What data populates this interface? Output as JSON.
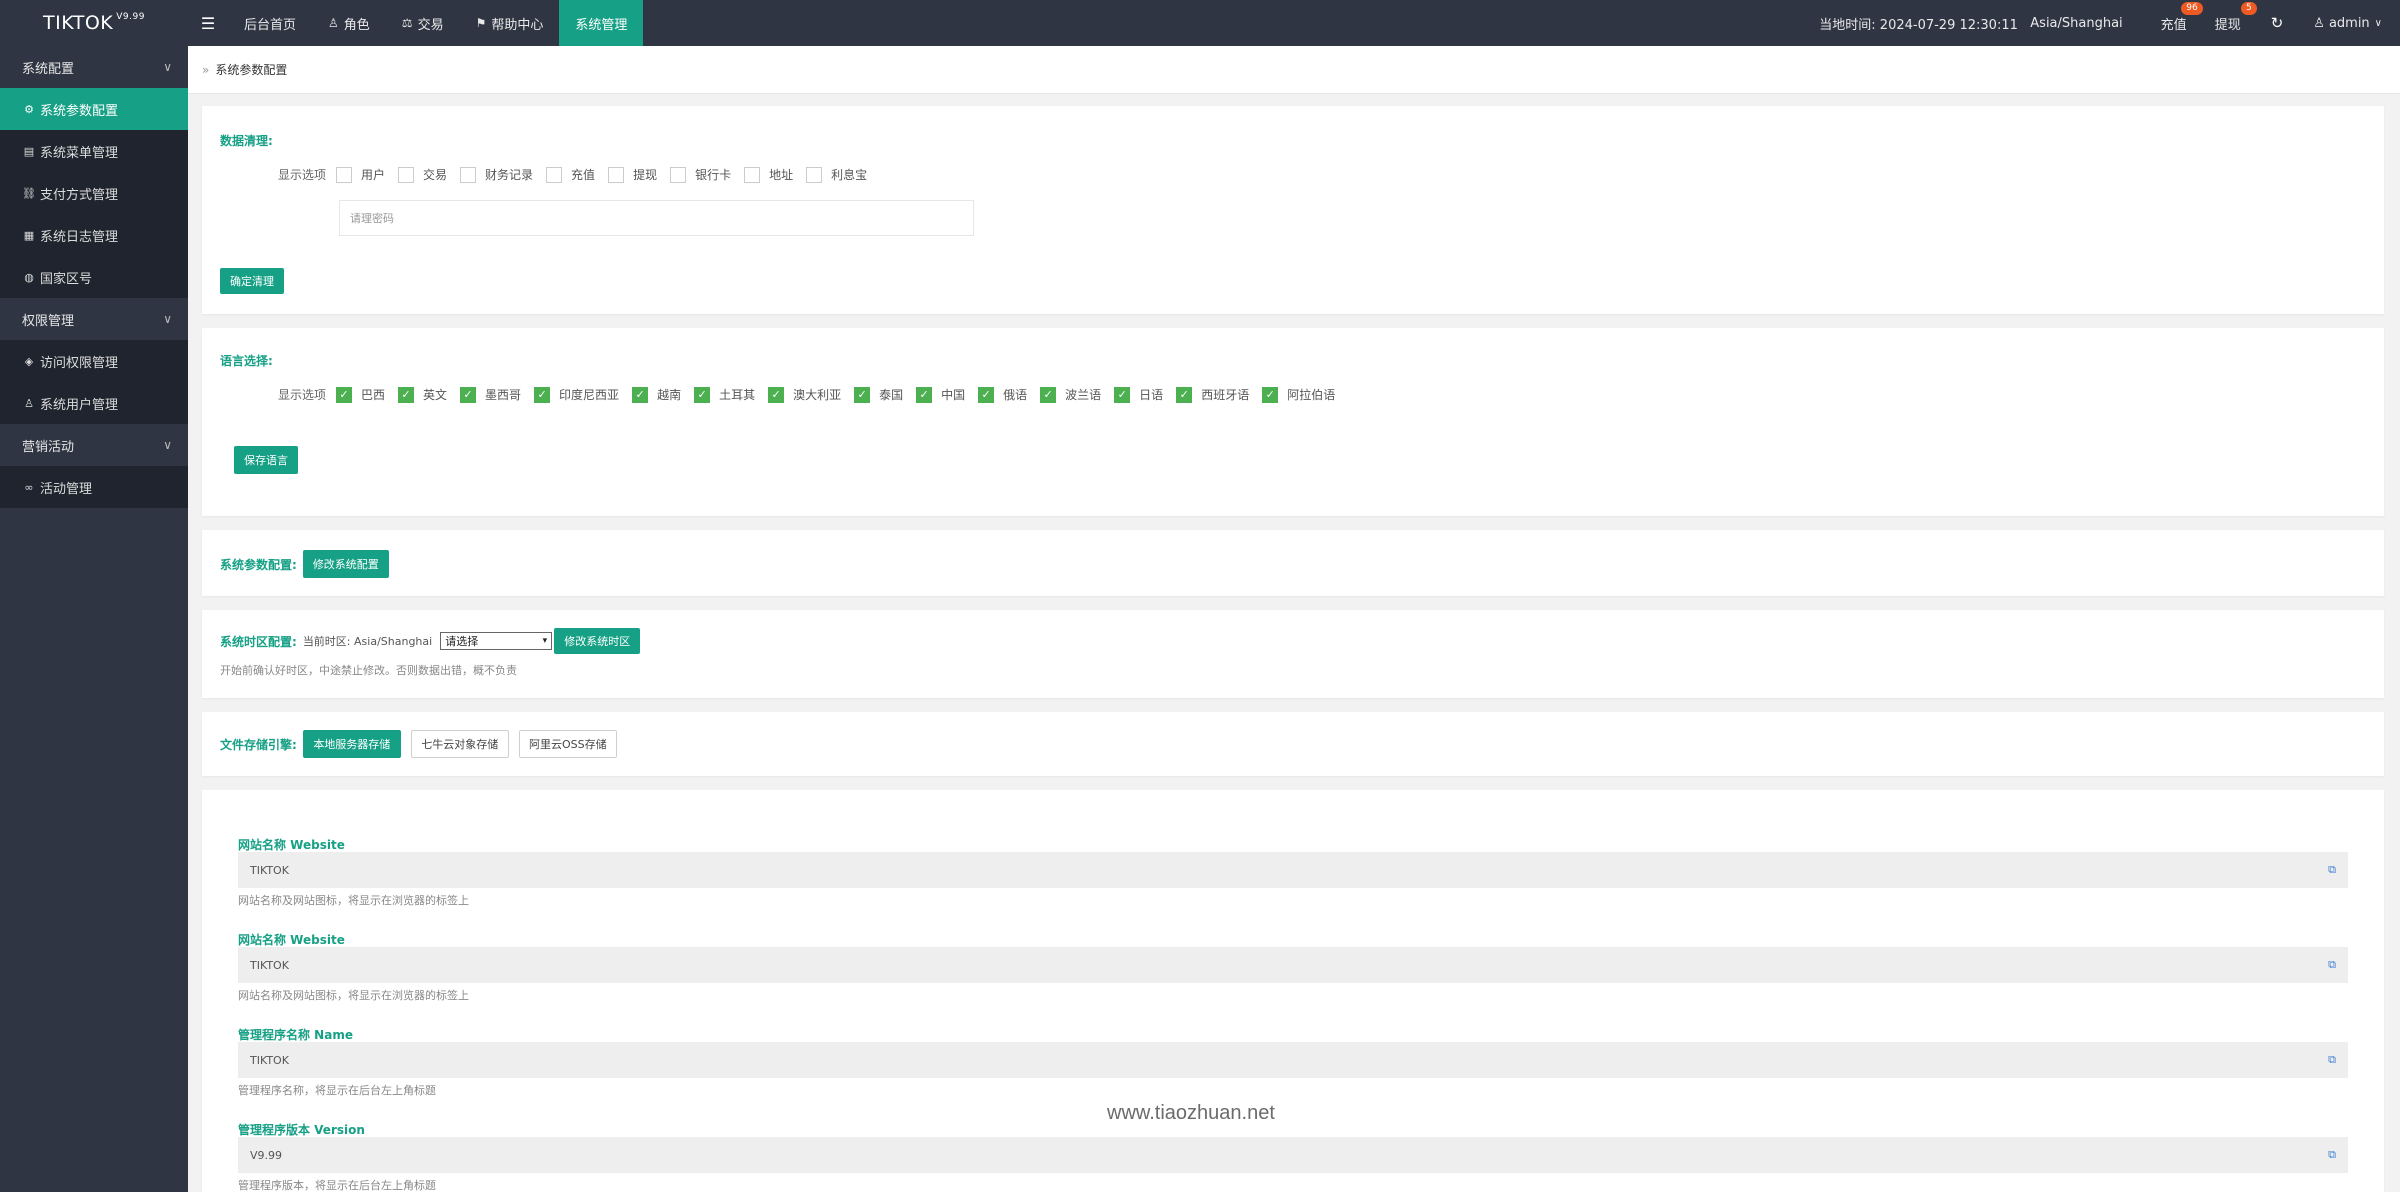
{
  "app": {
    "logo": "TIKTOK",
    "version": "V9.99"
  },
  "topnav": {
    "items": [
      {
        "label": "后台首页",
        "icon": ""
      },
      {
        "label": "角色",
        "icon": "user-icon"
      },
      {
        "label": "交易",
        "icon": "scale-icon"
      },
      {
        "label": "帮助中心",
        "icon": "flag-icon"
      },
      {
        "label": "系统管理",
        "icon": ""
      }
    ],
    "time_label": "当地时间: 2024-07-29 12:30:11",
    "timezone": "Asia/Shanghai",
    "recharge": {
      "label": "充值",
      "badge": "96"
    },
    "withdraw": {
      "label": "提现",
      "badge": "5"
    },
    "user": "admin"
  },
  "sidebar": {
    "groups": [
      {
        "label": "系统配置"
      },
      {
        "label": "权限管理"
      },
      {
        "label": "营销活动"
      }
    ],
    "items": [
      {
        "label": "系统参数配置",
        "icon": "gear-icon"
      },
      {
        "label": "系统菜单管理",
        "icon": "calendar-icon"
      },
      {
        "label": "支付方式管理",
        "icon": "link-icon"
      },
      {
        "label": "系统日志管理",
        "icon": "document-icon"
      },
      {
        "label": "国家区号",
        "icon": "globe-icon"
      },
      {
        "label": "访问权限管理",
        "icon": "shield-check-icon"
      },
      {
        "label": "系统用户管理",
        "icon": "user-icon"
      },
      {
        "label": "活动管理",
        "icon": "infinity-icon"
      }
    ]
  },
  "breadcrumb": "系统参数配置",
  "data_clean": {
    "title": "数据清理:",
    "lead": "显示选项",
    "options": [
      "用户",
      "交易",
      "财务记录",
      "充值",
      "提现",
      "银行卡",
      "地址",
      "利息宝"
    ],
    "password_placeholder": "请理密码",
    "button": "确定清理"
  },
  "language": {
    "title": "语言选择:",
    "lead": "显示选项",
    "options": [
      "巴西",
      "英文",
      "墨西哥",
      "印度尼西亚",
      "越南",
      "土耳其",
      "澳大利亚",
      "泰国",
      "中国",
      "俄语",
      "波兰语",
      "日语",
      "西班牙语",
      "阿拉伯语"
    ],
    "button": "保存语言"
  },
  "sys_params": {
    "title": "系统参数配置:",
    "button": "修改系统配置"
  },
  "timezone_cfg": {
    "title": "系统时区配置:",
    "current": "当前时区: Asia/Shanghai",
    "select_value": "请选择",
    "button": "修改系统时区",
    "help": "开始前确认好时区，中途禁止修改。否则数据出错，概不负责"
  },
  "storage": {
    "title": "文件存储引擎:",
    "buttons": [
      "本地服务器存储",
      "七牛云对象存储",
      "阿里云OSS存储"
    ]
  },
  "fields": [
    {
      "label": "网站名称 Website",
      "value": "TIKTOK",
      "help": "网站名称及网站图标，将显示在浏览器的标签上"
    },
    {
      "label": "网站名称 Website",
      "value": "TIKTOK",
      "help": "网站名称及网站图标，将显示在浏览器的标签上"
    },
    {
      "label": "管理程序名称 Name",
      "value": "TIKTOK",
      "help": "管理程序名称，将显示在后台左上角标题"
    },
    {
      "label": "管理程序版本 Version",
      "value": "V9.99",
      "help": "管理程序版本，将显示在后台左上角标题"
    }
  ],
  "watermark": "www.tiaozhuan.net",
  "colors": {
    "accent": "#16a085",
    "sidebar": "#2f3542",
    "sidebar_sub": "#1f242e",
    "badge": "#ee5a24"
  }
}
